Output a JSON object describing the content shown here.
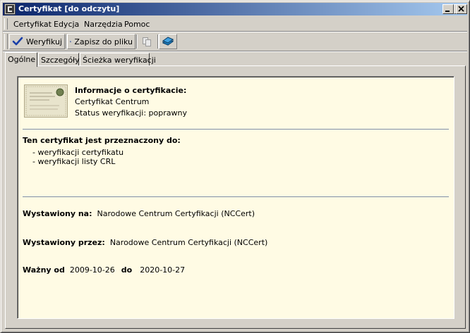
{
  "window": {
    "title": "Certyfikat [do odczytu]"
  },
  "menu": {
    "items": [
      "Certyfikat",
      "Edycja",
      "Narzędzia",
      "Pomoc"
    ]
  },
  "toolbar": {
    "verify_label": "Weryfikuj",
    "save_label": "Zapisz do pliku"
  },
  "tabs": [
    "Ogólne",
    "Szczegóły",
    "Ścieżka weryfikacji"
  ],
  "info": {
    "heading": "Informacje o certyfikacie:",
    "cert_name": "Certyfikat Centrum",
    "status": "Status weryfikacji: poprawny"
  },
  "purpose": {
    "heading": "Ten certyfikat jest przeznaczony do:",
    "items": [
      "- weryfikacji certyfikatu",
      "- weryfikacji listy CRL"
    ]
  },
  "issued_to": {
    "label": "Wystawiony na:",
    "value": "Narodowe Centrum Certyfikacji (NCCert)"
  },
  "issued_by": {
    "label": "Wystawiony przez:",
    "value": "Narodowe Centrum Certyfikacji (NCCert)"
  },
  "validity": {
    "from_label": "Ważny od",
    "from": "2009-10-26",
    "to_label": "do",
    "to": "2020-10-27"
  }
}
